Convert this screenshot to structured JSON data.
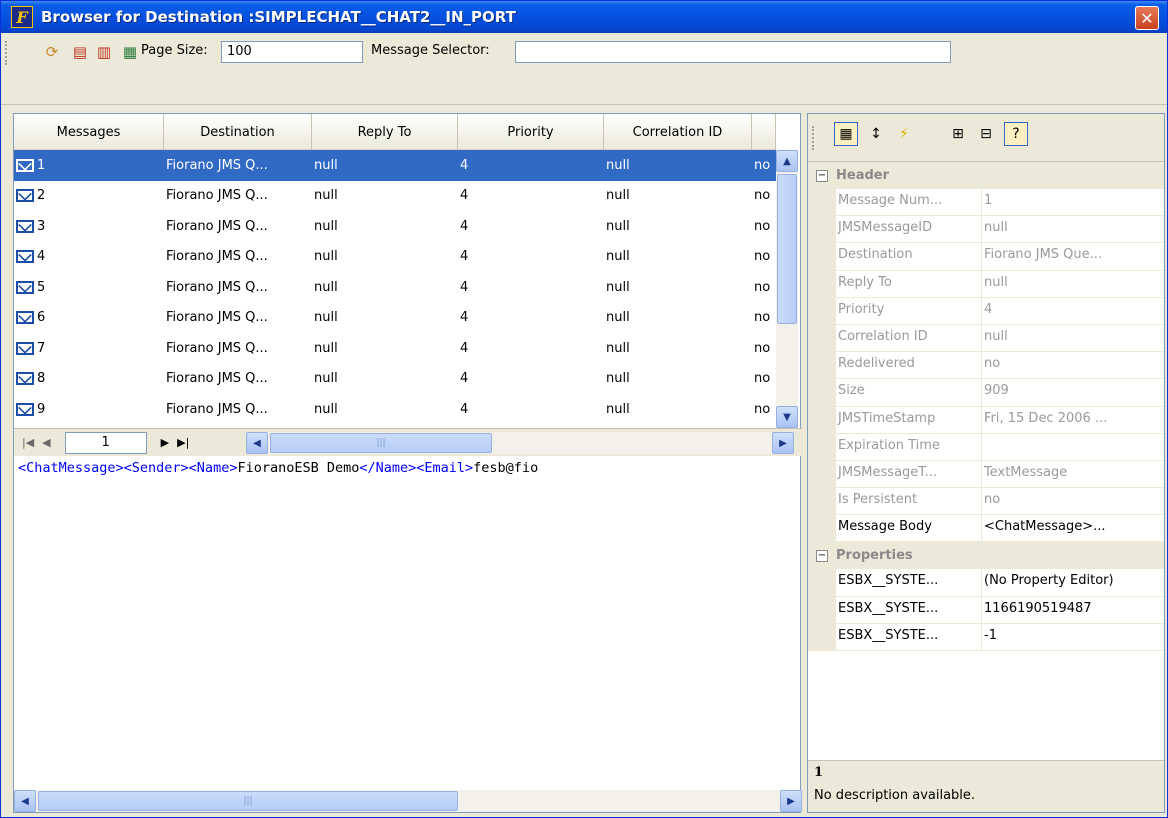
{
  "window": {
    "title": "Browser for Destination :SIMPLECHAT__CHAT2__IN_PORT",
    "app_icon_letter": "F",
    "close_label": "✕"
  },
  "toolbar": {
    "page_size_label": "Page Size:",
    "page_size_value": "100",
    "message_selector_label": "Message Selector:",
    "message_selector_value": ""
  },
  "table": {
    "columns": [
      "Messages",
      "Destination",
      "Reply To",
      "Priority",
      "Correlation ID"
    ],
    "rows": [
      {
        "msg": "1",
        "dest": "Fiorano JMS Q...",
        "reply": "null",
        "prio": "4",
        "corr": "null",
        "more": "no"
      },
      {
        "msg": "2",
        "dest": "Fiorano JMS Q...",
        "reply": "null",
        "prio": "4",
        "corr": "null",
        "more": "no"
      },
      {
        "msg": "3",
        "dest": "Fiorano JMS Q...",
        "reply": "null",
        "prio": "4",
        "corr": "null",
        "more": "no"
      },
      {
        "msg": "4",
        "dest": "Fiorano JMS Q...",
        "reply": "null",
        "prio": "4",
        "corr": "null",
        "more": "no"
      },
      {
        "msg": "5",
        "dest": "Fiorano JMS Q...",
        "reply": "null",
        "prio": "4",
        "corr": "null",
        "more": "no"
      },
      {
        "msg": "6",
        "dest": "Fiorano JMS Q...",
        "reply": "null",
        "prio": "4",
        "corr": "null",
        "more": "no"
      },
      {
        "msg": "7",
        "dest": "Fiorano JMS Q...",
        "reply": "null",
        "prio": "4",
        "corr": "null",
        "more": "no"
      },
      {
        "msg": "8",
        "dest": "Fiorano JMS Q...",
        "reply": "null",
        "prio": "4",
        "corr": "null",
        "more": "no"
      },
      {
        "msg": "9",
        "dest": "Fiorano JMS Q...",
        "reply": "null",
        "prio": "4",
        "corr": "null",
        "more": "no"
      }
    ]
  },
  "pager": {
    "page_number": "1"
  },
  "message_body": {
    "tag1": "<ChatMessage><Sender><Name>",
    "text1": "FioranoESB Demo",
    "tag2": "</Name><Email>",
    "text2": "fesb@fio"
  },
  "properties": {
    "header_category": "Header",
    "header": [
      {
        "name": "Message Num...",
        "value": "1"
      },
      {
        "name": "JMSMessageID",
        "value": "null"
      },
      {
        "name": "Destination",
        "value": "Fiorano JMS Que..."
      },
      {
        "name": "Reply To",
        "value": "null"
      },
      {
        "name": "Priority",
        "value": "4"
      },
      {
        "name": "Correlation ID",
        "value": "null"
      },
      {
        "name": "Redelivered",
        "value": "no"
      },
      {
        "name": "Size",
        "value": "909"
      },
      {
        "name": "JMSTimeStamp",
        "value": "Fri, 15 Dec 2006 ..."
      },
      {
        "name": "Expiration Time",
        "value": ""
      },
      {
        "name": "JMSMessageT...",
        "value": "TextMessage"
      },
      {
        "name": "Is Persistent",
        "value": "no"
      },
      {
        "name": "Message Body",
        "value": "<ChatMessage>..."
      }
    ],
    "properties_category": "Properties",
    "props": [
      {
        "name": "ESBX__SYSTE...",
        "value": "(No Property Editor)"
      },
      {
        "name": "ESBX__SYSTE...",
        "value": "1166190519487"
      },
      {
        "name": "ESBX__SYSTE...",
        "value": "-1"
      }
    ]
  },
  "description": {
    "title": "1",
    "text": "No description available."
  },
  "colors": {
    "title_bar": "#0a5ee8",
    "selection": "#316ac5",
    "xml_tag": "#0000ff"
  }
}
